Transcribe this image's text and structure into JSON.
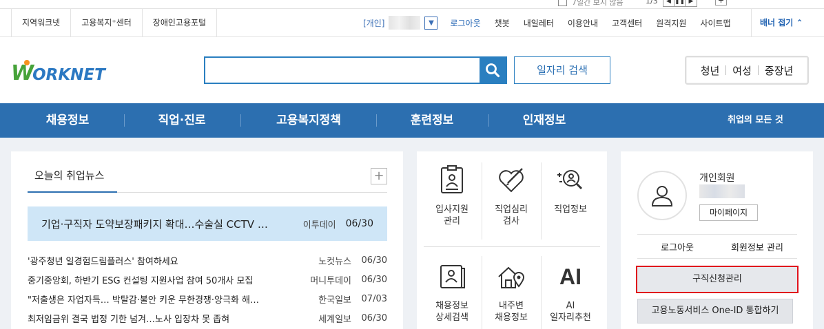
{
  "top_strip": {
    "checkbox_label": "7일간 보지 않음",
    "page_indicator": "1/3",
    "controls": [
      "◀",
      "❚❚",
      "▶"
    ],
    "add": "+"
  },
  "utility": {
    "left_links": [
      "지역워크넷",
      "고용복지⁺센터",
      "장애인고용포털"
    ],
    "member_type": "[개인]",
    "right_links": [
      "로그아웃",
      "챗봇",
      "내일레터",
      "이용안내",
      "고객센터",
      "원격지원",
      "사이트맵"
    ],
    "banner_fold": "배너 접기 ⌃"
  },
  "header": {
    "logo_w": "W",
    "logo_rest": "ORKNET",
    "search_placeholder": "",
    "job_search_label": "일자리 검색",
    "quick_links": [
      "청년",
      "여성",
      "중장년"
    ]
  },
  "gnb": {
    "items": [
      "채용정보",
      "직업·진로",
      "고용복지정책",
      "훈련정보",
      "인재정보"
    ],
    "all_label": "취업의 모든 것"
  },
  "news": {
    "tab_label": "오늘의 취업뉴스",
    "more": "+",
    "highlight": {
      "title": "기업·구직자 도약보장패키지 확대…수술실 CCTV …",
      "source": "이투데이",
      "date": "06/30"
    },
    "items": [
      {
        "title": "'광주청년 일경험드림플러스' 참여하세요",
        "source": "노컷뉴스",
        "date": "06/30"
      },
      {
        "title": "중기중앙회, 하반기 ESG 컨설팅 지원사업 참여 50개사 모집",
        "source": "머니투데이",
        "date": "06/30"
      },
      {
        "title": "\"저출생은 자업자득… 박탈감·불안 키운 무한경쟁·양극화 해…",
        "source": "한국일보",
        "date": "07/03"
      },
      {
        "title": "최저임금위 결국 법정 기한 넘겨…노사 입장차 못 좁혀",
        "source": "세계일보",
        "date": "06/30"
      }
    ]
  },
  "menu": {
    "items": [
      {
        "line1": "입사지원",
        "line2": "관리",
        "icon": "resume-board-icon"
      },
      {
        "line1": "직업심리",
        "line2": "검사",
        "icon": "heart-pencil-icon"
      },
      {
        "line1": "직업정보",
        "line2": "",
        "icon": "magnifier-person-icon"
      },
      {
        "line1": "채용정보",
        "line2": "상세검색",
        "icon": "scroll-person-icon"
      },
      {
        "line1": "내주변",
        "line2": "채용정보",
        "icon": "house-pin-icon"
      },
      {
        "line1": "AI",
        "line2": "일자리추천",
        "icon": "ai-icon"
      }
    ],
    "ai_glyph": "AI"
  },
  "user": {
    "type": "개인회원",
    "mypage_label": "마이페이지",
    "logout_label": "로그아웃",
    "member_info_label": "회원정보 관리",
    "job_request_label": "구직신청관리",
    "one_id_label": "고용노동서비스 One-ID 통합하기"
  },
  "colors": {
    "brand_blue": "#2c6fb0",
    "highlight_bg": "#cfe6f7",
    "red_outline": "#e0121c",
    "logo_green": "#47a33a",
    "logo_orange": "#f7931e"
  }
}
